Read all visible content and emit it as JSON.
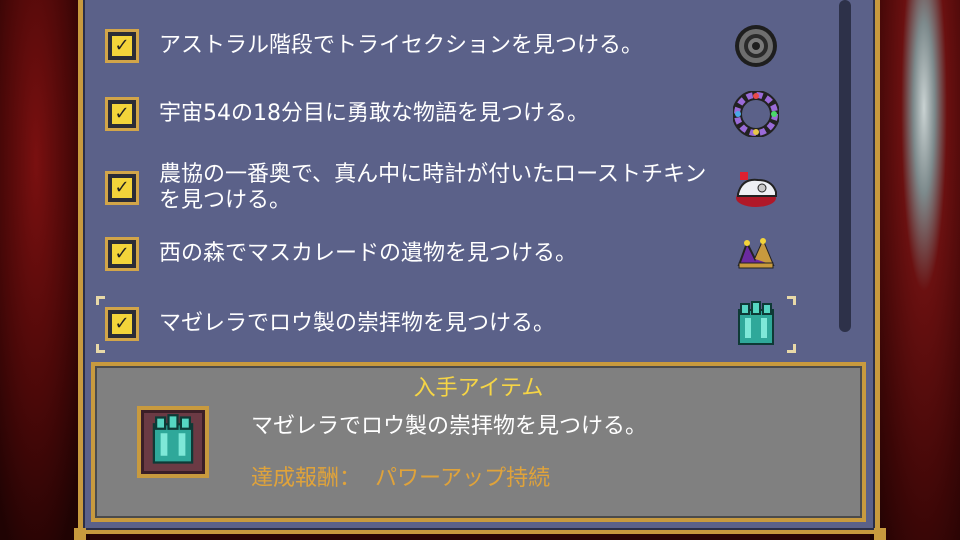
{
  "quests": [
    {
      "text": "アストラル階段でトライセクションを見つける。",
      "checked": true,
      "icon": "gear-disc-icon"
    },
    {
      "text": "宇宙54の18分目に勇敢な物語を見つける。",
      "checked": true,
      "icon": "jeweled-ring-icon"
    },
    {
      "text": "農協の一番奥で、真ん中に時計が付いたローストチキンを見つける。",
      "checked": true,
      "icon": "roast-chicken-icon"
    },
    {
      "text": "西の森でマスカレードの遺物を見つける。",
      "checked": true,
      "icon": "jester-hat-icon"
    },
    {
      "text": "マゼレラでロウ製の崇拝物を見つける。",
      "checked": true,
      "icon": "wax-idol-icon",
      "selected": true
    }
  ],
  "detail": {
    "header": "入手アイテム",
    "item_name": "マゼレラでロウ製の崇拝物を見つける。",
    "reward_label": "達成報酬：",
    "reward_value": "パワーアップ持続",
    "icon": "wax-idol-icon"
  },
  "colors": {
    "panel": "#5b6189",
    "gold_border": "#c89a3e",
    "check_yellow": "#f3d43a",
    "header_yellow": "#f6d545",
    "reward_orange": "#e0a33a",
    "info_gray": "#808080"
  }
}
